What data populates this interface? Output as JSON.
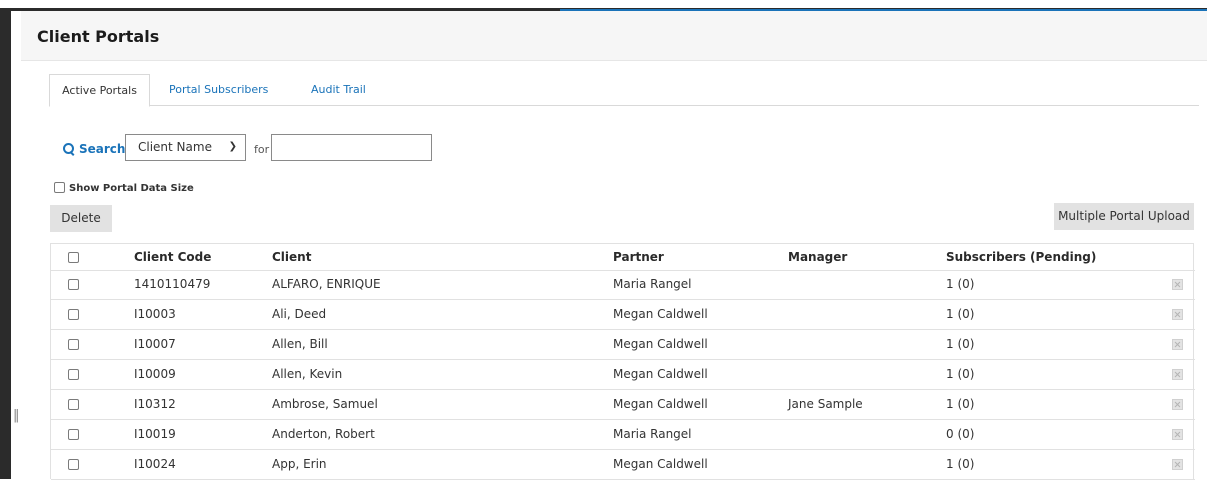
{
  "page": {
    "title": "Client Portals"
  },
  "tabs": [
    {
      "label": "Active Portals",
      "active": true
    },
    {
      "label": "Portal Subscribers",
      "active": false
    },
    {
      "label": "Audit Trail",
      "active": false
    }
  ],
  "search": {
    "label": "Search",
    "field_value": "Client Name",
    "for_label": "for",
    "query": ""
  },
  "options": {
    "show_size_label": "Show Portal Data Size",
    "show_size_checked": false
  },
  "toolbar": {
    "delete_label": "Delete",
    "upload_label": "Multiple Portal Upload"
  },
  "table": {
    "headers": [
      "Client Code",
      "Client",
      "Partner",
      "Manager",
      "Subscribers (Pending)"
    ],
    "rows": [
      [
        "1410110479",
        "ALFARO, ENRIQUE",
        "Maria Rangel",
        "",
        "1 (0)"
      ],
      [
        "I10003",
        "Ali, Deed",
        "Megan Caldwell",
        "",
        "1 (0)"
      ],
      [
        "I10007",
        "Allen, Bill",
        "Megan Caldwell",
        "",
        "1 (0)"
      ],
      [
        "I10009",
        "Allen, Kevin",
        "Megan Caldwell",
        "",
        "1 (0)"
      ],
      [
        "I10312",
        "Ambrose, Samuel",
        "Megan Caldwell",
        "Jane Sample",
        "1 (0)"
      ],
      [
        "I10019",
        "Anderton, Robert",
        "Maria Rangel",
        "",
        "0 (0)"
      ],
      [
        "I10024",
        "App, Erin",
        "Megan Caldwell",
        "",
        "1 (0)"
      ]
    ]
  },
  "icons": {
    "search": "search-icon",
    "dropdown": "chevron-down-icon",
    "row_action": "delete-icon",
    "resize": "resize-handle-icon"
  },
  "colors": {
    "accent": "#1a73b9",
    "button_bg": "#e2e2e2",
    "header_bg": "#f6f6f6"
  }
}
